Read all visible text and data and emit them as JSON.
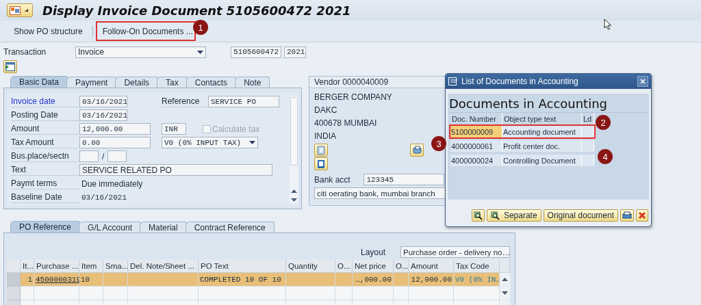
{
  "window": {
    "title": "Display Invoice Document 5105600472 2021"
  },
  "toolbar": [
    {
      "label": "Show PO structure",
      "highlighted": false
    },
    {
      "label": "Follow-On Documents ...",
      "highlighted": true
    }
  ],
  "header": {
    "transaction_label": "Transaction",
    "transaction_value": "Invoice",
    "document_number": "5105600472",
    "year": "2021"
  },
  "tabs": [
    {
      "label": "Basic Data",
      "selected": true
    },
    {
      "label": "Payment",
      "selected": false
    },
    {
      "label": "Details",
      "selected": false
    },
    {
      "label": "Tax",
      "selected": false
    },
    {
      "label": "Contacts",
      "selected": false
    },
    {
      "label": "Note",
      "selected": false
    }
  ],
  "basic_data": {
    "invoice_date": {
      "label": "Invoice date",
      "value": "03/16/2021"
    },
    "reference": {
      "label": "Reference",
      "value": "SERVICE PO"
    },
    "posting_date": {
      "label": "Posting Date",
      "value": "03/16/2021"
    },
    "amount": {
      "label": "Amount",
      "value": "12,000.00",
      "currency": "INR"
    },
    "calculate_tax": {
      "label": "Calculate tax",
      "checked": false,
      "disabled": true
    },
    "tax_amount": {
      "label": "Tax Amount",
      "value": "0.00",
      "tax_code": "V0 (0% INPUT TAX)"
    },
    "bus_place": {
      "label": "Bus.place/sectn",
      "separator": "/"
    },
    "text": {
      "label": "Text",
      "value": "SERVICE RELATED PO"
    },
    "payment_terms": {
      "label": "Paymt terms",
      "value": "Due immediately"
    },
    "baseline_date": {
      "label": "Baseline Date",
      "value": "03/16/2021"
    }
  },
  "vendor": {
    "title": "Vendor 0000040009",
    "address": [
      "BERGER COMPANY",
      "DAKC",
      "400678 MUMBAI",
      "INDIA"
    ],
    "bank_label": "Bank acct",
    "bank_account": "123345",
    "bank_name": "citi oerating bank, mumbai branch"
  },
  "popup": {
    "title": "List of Documents in Accounting",
    "heading": "Documents in Accounting",
    "columns": [
      "Doc. Number",
      "Object type text",
      "Ld"
    ],
    "rows": [
      {
        "doc_number": "5100000009",
        "type": "Accounting document",
        "selected": true,
        "highlighted": true
      },
      {
        "doc_number": "4000000061",
        "type": "Profit center doc.",
        "selected": false,
        "highlighted": false
      },
      {
        "doc_number": "4000000024",
        "type": "Controlling Document",
        "selected": false,
        "highlighted": false
      }
    ],
    "buttons": [
      {
        "label": "Separate"
      },
      {
        "label": "Original document"
      }
    ]
  },
  "lower_tabs": [
    {
      "label": "PO Reference",
      "selected": true
    },
    {
      "label": "G/L Account",
      "selected": false
    },
    {
      "label": "Material",
      "selected": false
    },
    {
      "label": "Contract Reference",
      "selected": false
    }
  ],
  "layout": {
    "label": "Layout",
    "value": "Purchase order - delivery no…"
  },
  "table": {
    "columns": [
      "It...",
      "Purchase ...",
      "Item",
      "Sma...",
      "Del. Note/Sheet ...",
      "PO Text",
      "Quantity",
      "O...",
      "Net price",
      "O...",
      "Amount",
      "Tax Code"
    ],
    "rows": [
      {
        "selected": true,
        "cells": [
          "1",
          "4500000319",
          "10",
          null,
          null,
          "COMPLETED 10 OF 10",
          null,
          null,
          "…,000.00",
          null,
          "12,000.00",
          "V0 (0% IN…"
        ]
      }
    ]
  },
  "annotations": [
    {
      "label": "1"
    },
    {
      "label": "2"
    },
    {
      "label": "3"
    },
    {
      "label": "4"
    }
  ]
}
